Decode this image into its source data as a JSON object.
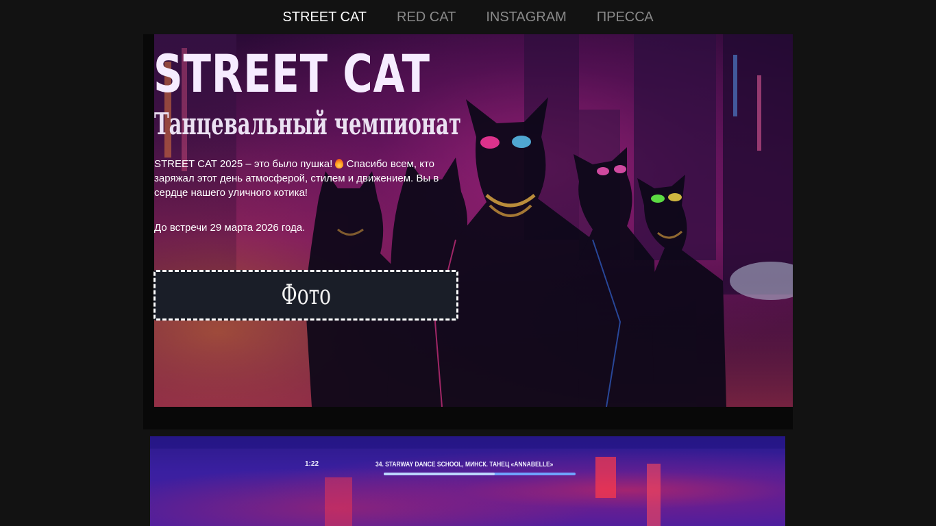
{
  "nav": {
    "items": [
      {
        "label": "STREET CAT",
        "active": true
      },
      {
        "label": "RED CAT",
        "active": false
      },
      {
        "label": "INSTAGRAM",
        "active": false
      },
      {
        "label": "ПРЕССА",
        "active": false
      }
    ]
  },
  "hero": {
    "title": "STREET CAT",
    "subtitle": "Танцевальный чемпионат",
    "text_part1": "STREET CAT 2025 – это было пушка!",
    "emoji_icon": "fire-icon",
    "text_part2": "Спасибо всем, кто заряжал этот день атмосферой, стилем и движением. Вы в сердце нашего уличного котика!",
    "text_closing": "До встречи 29 марта 2026 года.",
    "photo_button_label": "Фото"
  },
  "video": {
    "time": "1:22",
    "caption": "34.   STARWAY DANCE SCHOOL, МИНСК. ТАНЕЦ «ANNABELLE»",
    "progress": 0.58
  },
  "colors": {
    "page_background": "#121212",
    "nav_active": "#ffffff",
    "nav_inactive": "#8a8a8a",
    "button_background": "#1a1e28"
  }
}
